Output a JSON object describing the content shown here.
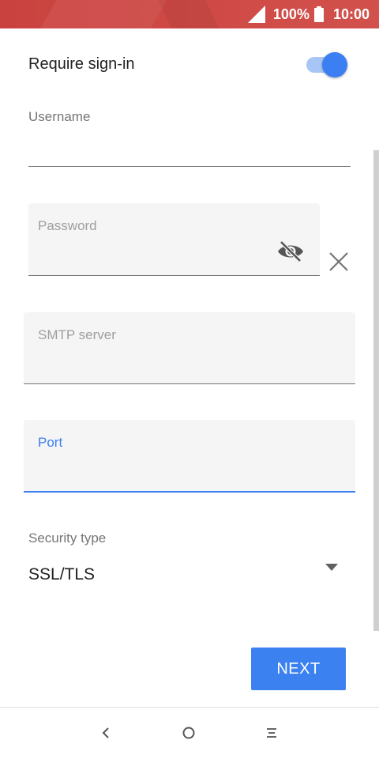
{
  "status_bar": {
    "battery_percent": "100%",
    "time": "10:00",
    "icons": [
      "signal-icon",
      "battery-icon"
    ],
    "color": "#c9423f"
  },
  "form": {
    "require_signin": {
      "label": "Require sign-in",
      "enabled": true
    },
    "username": {
      "label": "Username",
      "value": ""
    },
    "password": {
      "placeholder": "Password",
      "value": "",
      "icons": [
        "visibility-off-icon",
        "close-icon"
      ]
    },
    "smtp_server": {
      "placeholder": "SMTP server",
      "value": ""
    },
    "port": {
      "placeholder": "Port",
      "value": "",
      "focused": true
    },
    "security_type": {
      "label": "Security type",
      "selected": "SSL/TLS"
    }
  },
  "actions": {
    "next_label": "NEXT"
  },
  "nav_bar": {
    "icons": [
      "back-icon",
      "home-icon",
      "recents-icon"
    ]
  },
  "colors": {
    "accent": "#3b7ff2",
    "text_primary": "#212121",
    "text_secondary": "#757575",
    "field_background": "#f5f5f5"
  }
}
